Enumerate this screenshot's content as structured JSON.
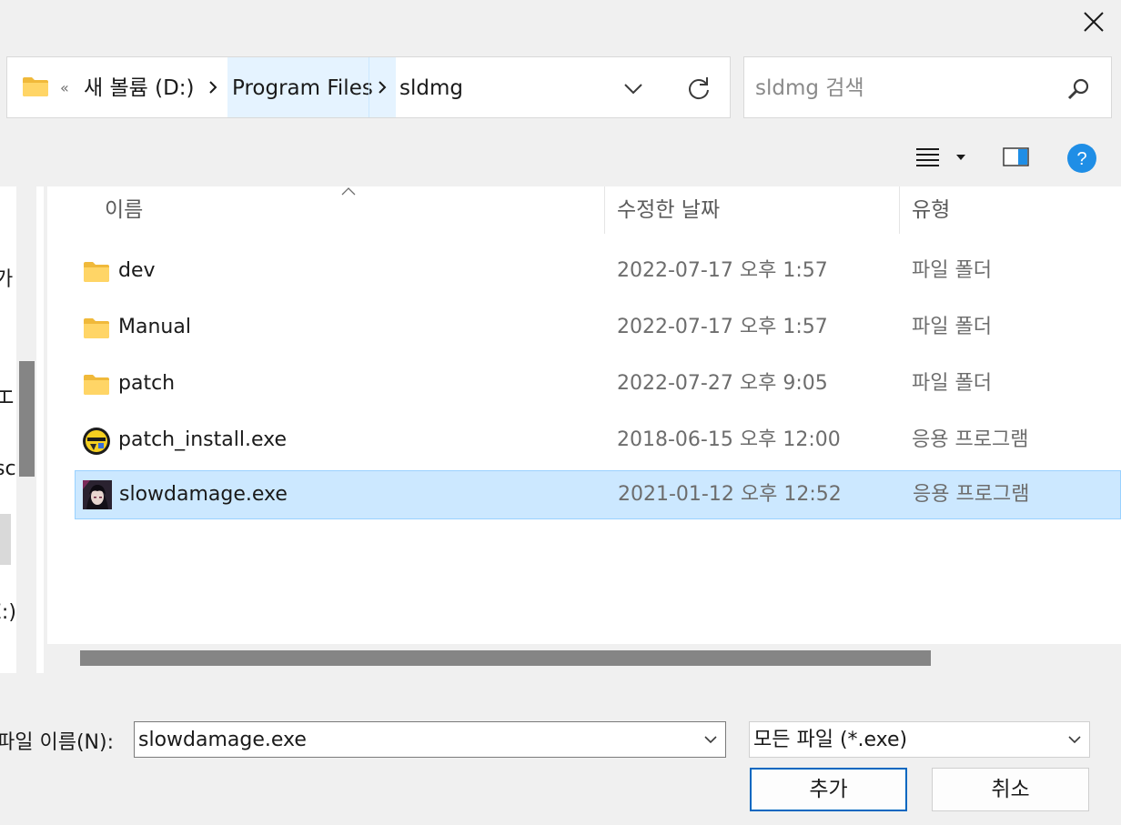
{
  "address": {
    "overflow": "«",
    "crumbs": [
      "새 볼륨 (D:)",
      "Program Files",
      "sldmg"
    ]
  },
  "search": {
    "placeholder": "sldmg 검색"
  },
  "nav_fragments": [
    "가",
    "エ",
    "sc",
    "E:)"
  ],
  "columns": {
    "name": "이름",
    "date": "수정한 날짜",
    "type": "유형"
  },
  "files": [
    {
      "name": "dev",
      "date": "2022-07-17 오후 1:57",
      "type": "파일 폴더",
      "icon": "folder-icon"
    },
    {
      "name": "Manual",
      "date": "2022-07-17 오후 1:57",
      "type": "파일 폴더",
      "icon": "folder-icon"
    },
    {
      "name": "patch",
      "date": "2022-07-27 오후 9:05",
      "type": "파일 폴더",
      "icon": "folder-icon"
    },
    {
      "name": "patch_install.exe",
      "date": "2018-06-15 오후 12:00",
      "type": "응용 프로그램",
      "icon": "installer-icon"
    },
    {
      "name": "slowdamage.exe",
      "date": "2021-01-12 오후 12:52",
      "type": "응용 프로그램",
      "icon": "app-portrait-icon",
      "selected": true
    }
  ],
  "filename": {
    "label": "파일 이름(N):",
    "value": "slowdamage.exe"
  },
  "filter": {
    "value": "모든 파일 (*.exe)"
  },
  "buttons": {
    "ok": "추가",
    "cancel": "취소"
  },
  "colors": {
    "selection": "#cce8ff",
    "selection_border": "#99d1ff",
    "help": "#1f8ee6",
    "primary_border": "#0067c0"
  }
}
